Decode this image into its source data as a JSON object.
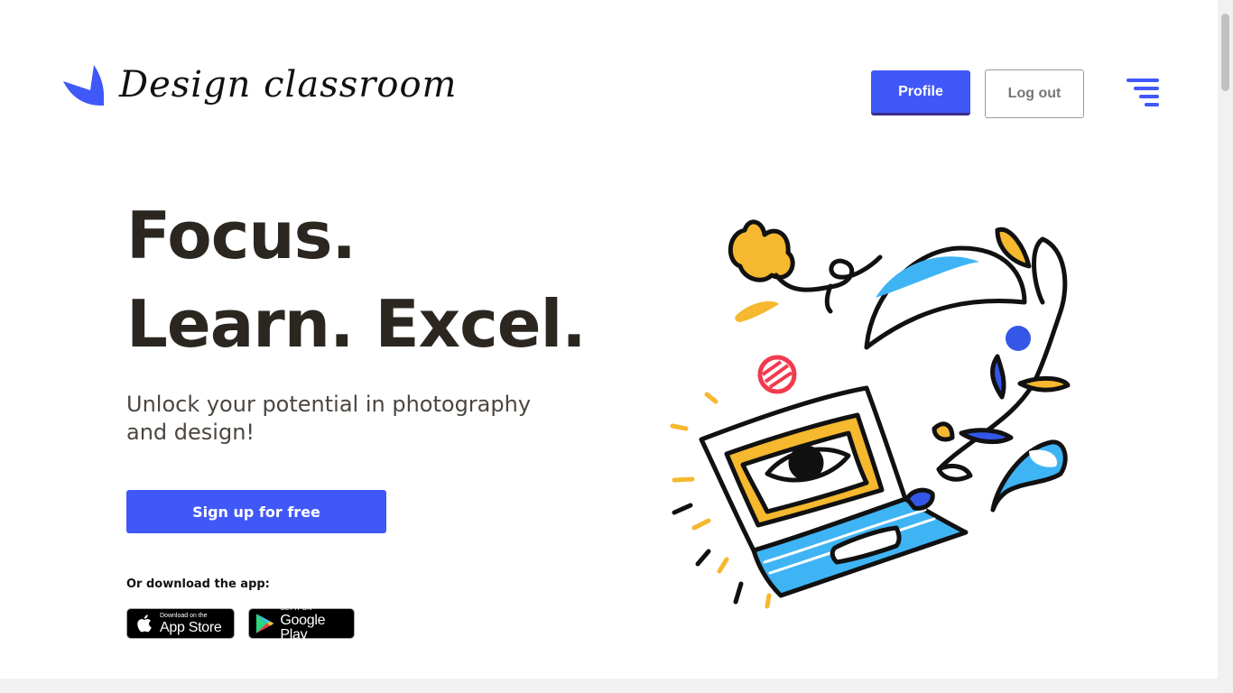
{
  "header": {
    "logo_text": "Design classroom",
    "profile_label": "Profile",
    "logout_label": "Log out",
    "menu_icon": "hamburger-menu-icon"
  },
  "hero": {
    "headline_line1": "Focus.",
    "headline_line2": "Learn. Excel.",
    "subtitle": "Unlock your potential in photography and design!",
    "cta_label": "Sign up for free",
    "download_label": "Or download the app:"
  },
  "badges": {
    "appstore_small": "Download on the",
    "appstore_big": "App Store",
    "google_small": "GET IT ON",
    "google_big": "Google Play"
  },
  "colors": {
    "accent": "#4158f8",
    "heading": "#2b2620",
    "illustration_yellow": "#f5b82e",
    "illustration_blue": "#3fb4f5",
    "illustration_red": "#f23a4e"
  }
}
